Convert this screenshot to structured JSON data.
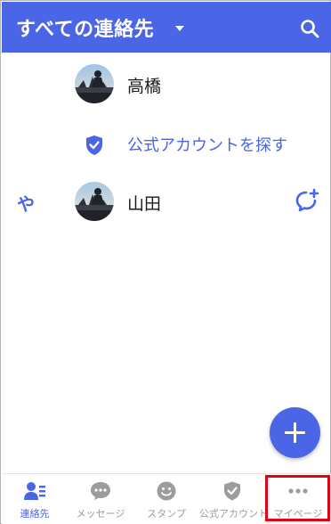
{
  "header": {
    "title": "すべての連絡先",
    "caret_icon": "caret-down-icon",
    "search_icon": "search-icon"
  },
  "contacts": [
    {
      "name": "高橋",
      "avatar_icon": "avatar-photo"
    },
    {
      "name": "山田",
      "avatar_icon": "avatar-photo"
    }
  ],
  "official": {
    "label": "公式アカウントを探す",
    "icon": "shield-check-icon"
  },
  "index": {
    "letter": "や"
  },
  "chat_add_icon": "chat-add-icon",
  "fab": {
    "icon": "plus-icon"
  },
  "tabs": [
    {
      "label": "連絡先",
      "icon": "contacts-icon",
      "active": true
    },
    {
      "label": "メッセージ",
      "icon": "message-icon",
      "active": false
    },
    {
      "label": "スタンプ",
      "icon": "sticker-icon",
      "active": false
    },
    {
      "label": "公式アカウント",
      "icon": "shield-check-icon",
      "active": false
    },
    {
      "label": "マイページ",
      "icon": "more-icon",
      "active": false
    }
  ],
  "colors": {
    "accent": "#4a65e6",
    "highlight": "#e60012",
    "inactive": "#9c9c9c"
  }
}
